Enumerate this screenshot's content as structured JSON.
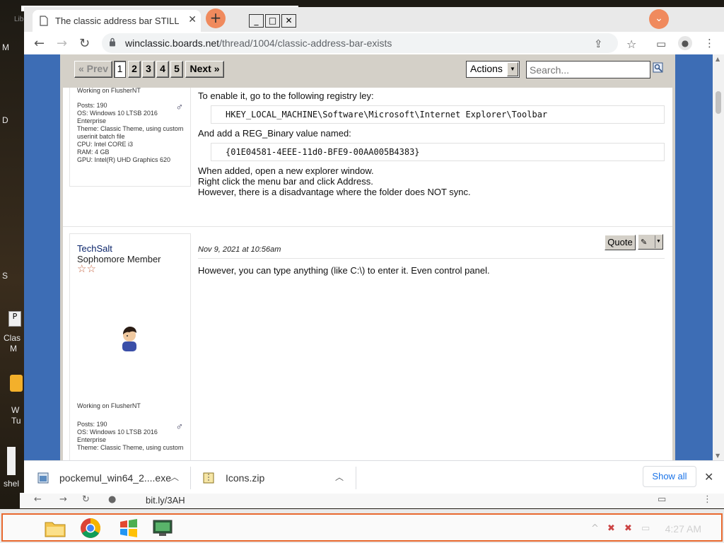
{
  "desktop": {
    "fragments": [
      "Lib",
      "M",
      "D",
      "S",
      "Clas",
      "M",
      "W",
      "Tu",
      "shel",
      "P"
    ]
  },
  "browser": {
    "tab_title": "The classic address bar STILL exis",
    "new_tab_symbol": "+",
    "window_buttons": [
      "_",
      "□",
      "✕"
    ],
    "url_domain": "winclassic.boards.net",
    "url_path": "/thread/1004/classic-address-bar-exists"
  },
  "forum": {
    "pager": {
      "prev_label": "« Prev",
      "pages": [
        "1",
        "2",
        "3",
        "4",
        "5"
      ],
      "current_page": "1",
      "next_label": "Next »"
    },
    "actions_label": "Actions",
    "search_placeholder": "Search..."
  },
  "post1": {
    "working_on": "Working on FlusherNT",
    "stats": [
      "Posts: 190",
      "OS: Windows 10 LTSB 2016",
      "Enterprise",
      "Theme: Classic Theme, using custom",
      "userinit batch file",
      "CPU: Intel CORE i3",
      "RAM: 4 GB",
      "GPU: Intel(R) UHD Graphics 620"
    ],
    "text1": "To enable it, go to the following registry ley:",
    "code1": "HKEY_LOCAL_MACHINE\\Software\\Microsoft\\Internet Explorer\\Toolbar",
    "text2": "And add a REG_Binary value named:",
    "code2": "{01E04581-4EEE-11d0-BFE9-00AA005B4383}",
    "text3": [
      "When added, open a new explorer window.",
      "Right click the menu bar and click Address.",
      "However, there is a disadvantage where the folder does NOT sync."
    ]
  },
  "post2": {
    "username": "TechSalt",
    "rank": "Sophomore Member",
    "date": "Nov 9, 2021 at 10:56am",
    "quote_label": "Quote",
    "message": "However, you can type anything (like C:\\) to enter it. Even control panel.",
    "working_on": "Working on FlusherNT",
    "stats": [
      "Posts: 190",
      "OS: Windows 10 LTSB 2016",
      "Enterprise",
      "Theme: Classic Theme, using custom"
    ]
  },
  "downloads": {
    "items": [
      {
        "name": "pockemul_win64_2....exe"
      },
      {
        "name": "Icons.zip"
      }
    ],
    "show_all_label": "Show all"
  },
  "ghost": {
    "url": "bit.ly/3AH"
  },
  "taskbar": {
    "clock": "4:27 AM"
  },
  "colors": {
    "forum_blue": "#3d6db5",
    "forum_panel": "#d4d0c8",
    "accent_orange": "#f08a5d",
    "taskbar_border": "#e8692f"
  }
}
